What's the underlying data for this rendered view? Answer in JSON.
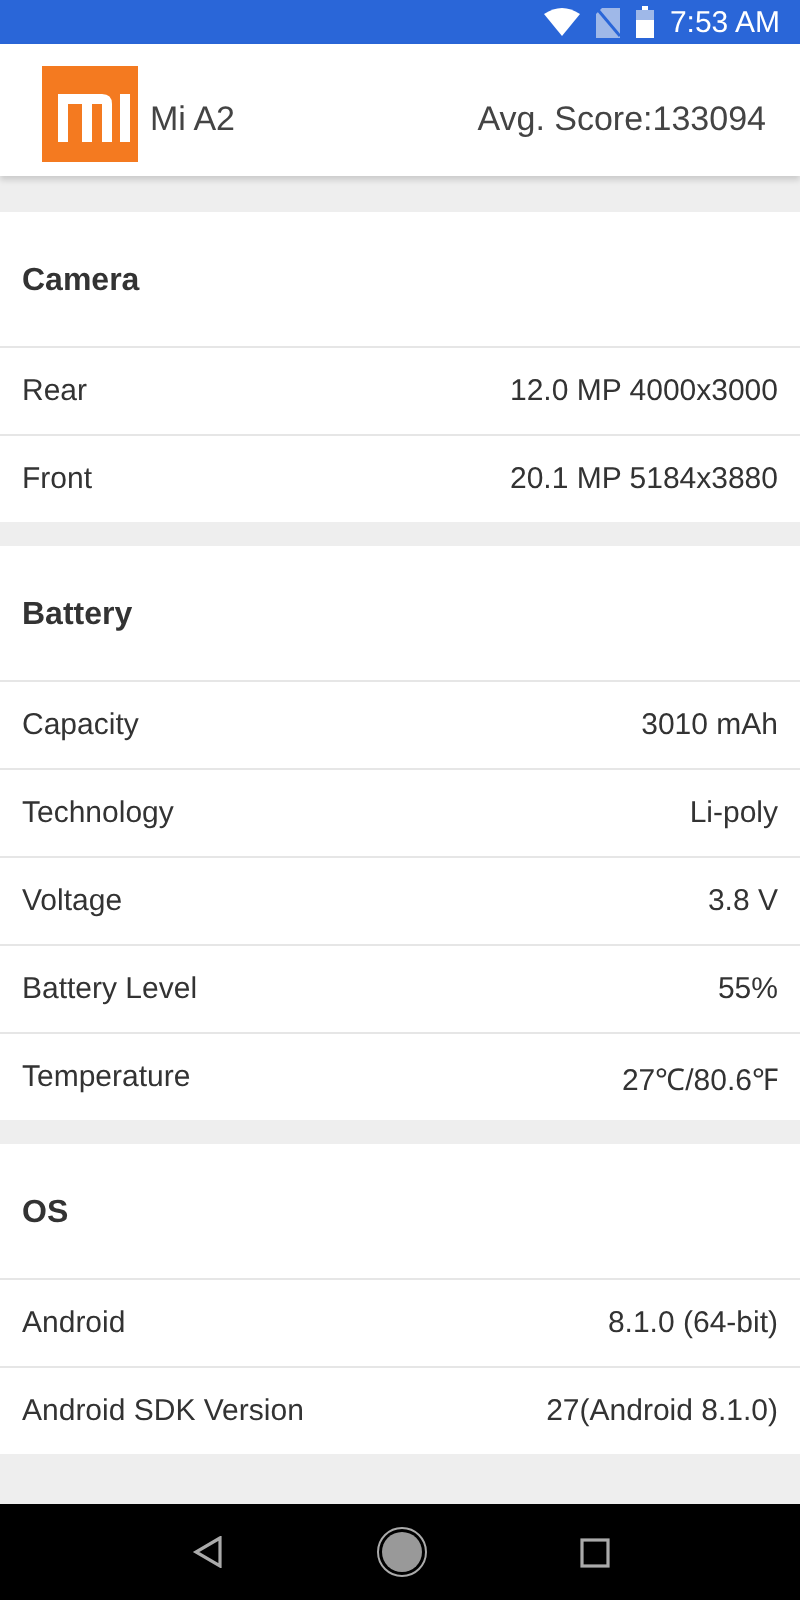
{
  "status_bar": {
    "time": "7:53 AM"
  },
  "header": {
    "device": "Mi A2",
    "score": "Avg. Score:133094"
  },
  "sections": [
    {
      "title": "Camera",
      "rows": [
        {
          "label": "Rear",
          "value": "12.0 MP 4000x3000"
        },
        {
          "label": "Front",
          "value": "20.1 MP 5184x3880"
        }
      ]
    },
    {
      "title": "Battery",
      "rows": [
        {
          "label": "Capacity",
          "value": "3010 mAh"
        },
        {
          "label": "Technology",
          "value": "Li-poly"
        },
        {
          "label": "Voltage",
          "value": "3.8 V"
        },
        {
          "label": "Battery Level",
          "value": "55%"
        },
        {
          "label": "Temperature",
          "value": "27℃/80.6℉"
        }
      ]
    },
    {
      "title": "OS",
      "rows": [
        {
          "label": "Android",
          "value": "8.1.0 (64-bit)"
        },
        {
          "label": "Android SDK Version",
          "value": "27(Android 8.1.0)"
        }
      ]
    }
  ]
}
